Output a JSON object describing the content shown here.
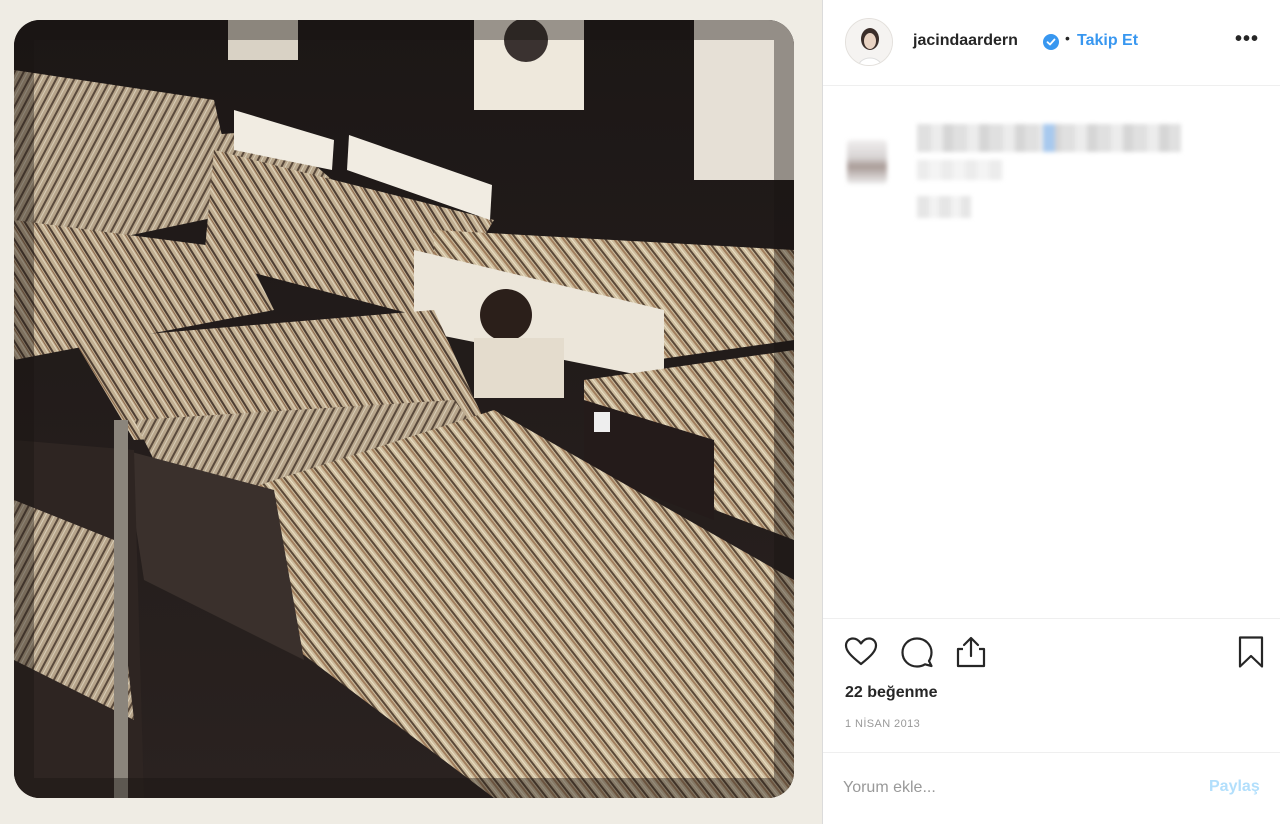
{
  "post": {
    "username": "jacindaardern",
    "separator": "•",
    "follow_label": "Takip Et",
    "more_label": "•••",
    "likes_count": "22",
    "likes_suffix": "beğenme",
    "date": "1 NİSAN 2013",
    "comment_placeholder": "Yorum ekle...",
    "post_label": "Paylaş"
  },
  "icons": {
    "verified": "verified-badge-icon",
    "like": "heart-icon",
    "comment": "comment-icon",
    "share": "share-icon",
    "save": "bookmark-icon",
    "more": "more-options-icon"
  },
  "colors": {
    "accent": "#3897f0",
    "post_disabled": "#b2dffc",
    "text": "#262626",
    "muted": "#999999"
  }
}
